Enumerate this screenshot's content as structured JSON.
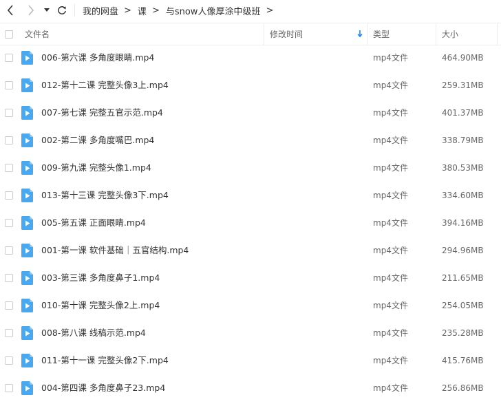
{
  "breadcrumb": [
    "我的网盘",
    "课",
    "与snow人像厚涂中级班"
  ],
  "header": {
    "name": "文件名",
    "modified": "修改时间",
    "type": "类型",
    "size": "大小"
  },
  "colors": {
    "accent": "#1e88e5",
    "file_icon": "#4aa8f0"
  },
  "icons": {
    "back": "chevron-left-icon",
    "forward": "chevron-right-icon",
    "dropdown": "caret-down-icon",
    "refresh": "refresh-icon",
    "file": "video-file-icon"
  },
  "files": [
    {
      "name": "006-第六课 多角度眼睛.mp4",
      "type": "mp4文件",
      "size": "464.90MB"
    },
    {
      "name": "012-第十二课 完整头像3上.mp4",
      "type": "mp4文件",
      "size": "259.31MB"
    },
    {
      "name": "007-第七课 完整五官示范.mp4",
      "type": "mp4文件",
      "size": "401.37MB"
    },
    {
      "name": "002-第二课 多角度嘴巴.mp4",
      "type": "mp4文件",
      "size": "338.79MB"
    },
    {
      "name": "009-第九课 完整头像1.mp4",
      "type": "mp4文件",
      "size": "380.53MB"
    },
    {
      "name": "013-第十三课 完整头像3下.mp4",
      "type": "mp4文件",
      "size": "334.60MB"
    },
    {
      "name": "005-第五课 正面眼睛.mp4",
      "type": "mp4文件",
      "size": "394.16MB"
    },
    {
      "name": "001-第一课 软件基础｜五官结构.mp4",
      "type": "mp4文件",
      "size": "294.96MB"
    },
    {
      "name": "003-第三课 多角度鼻子1.mp4",
      "type": "mp4文件",
      "size": "211.65MB"
    },
    {
      "name": "010-第十课 完整头像2上.mp4",
      "type": "mp4文件",
      "size": "254.05MB"
    },
    {
      "name": "008-第八课 线稿示范.mp4",
      "type": "mp4文件",
      "size": "235.28MB"
    },
    {
      "name": "011-第十一课 完整头像2下.mp4",
      "type": "mp4文件",
      "size": "415.76MB"
    },
    {
      "name": "004-第四课 多角度鼻子23.mp4",
      "type": "mp4文件",
      "size": "256.86MB"
    }
  ]
}
